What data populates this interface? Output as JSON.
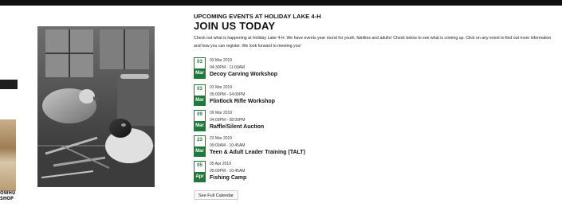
{
  "section": {
    "heading": "UPCOMING EVENTS AT HOLIDAY LAKE 4-H",
    "title": "JOIN US TODAY",
    "intro": "Check out what is happening at Holiday Lake 4-H. We have events year round for youth, families and adults! Check below to see what is coming up. Click on any event to find out more information and how you can register. We look forward to meeting you!"
  },
  "left_partial_text": {
    "line1": "OWHU",
    "line2": "SHOP"
  },
  "events": [
    {
      "day": "03",
      "month": "Mar",
      "date": "03 Mar 2019",
      "time": "04:30PM - 11:00AM",
      "title": "Decoy Carving Workshop"
    },
    {
      "day": "03",
      "month": "Mar",
      "date": "03 Mar 2019",
      "time": "05:00PM - 04:00PM",
      "title": "Flintlock Rifle Workshop"
    },
    {
      "day": "09",
      "month": "Mar",
      "date": "09 Mar 2019",
      "time": "04:00PM - 08:00PM",
      "title": "Raffle/Silent Auction"
    },
    {
      "day": "23",
      "month": "Mar",
      "date": "23 Mar 2019",
      "time": "09:00AM - 10:45AM",
      "title": "Teen & Adult Leader Training (TALT)"
    },
    {
      "day": "05",
      "month": "Apr",
      "date": "05 Apr 2019",
      "time": "05:00PM - 10:45AM",
      "title": "Fishing Camp"
    }
  ],
  "calendar_button": "See Full Calendar",
  "colors": {
    "accent": "#1e7a3c",
    "topbar": "#111111"
  },
  "image": {
    "subject": "decoy-carving-photo"
  }
}
